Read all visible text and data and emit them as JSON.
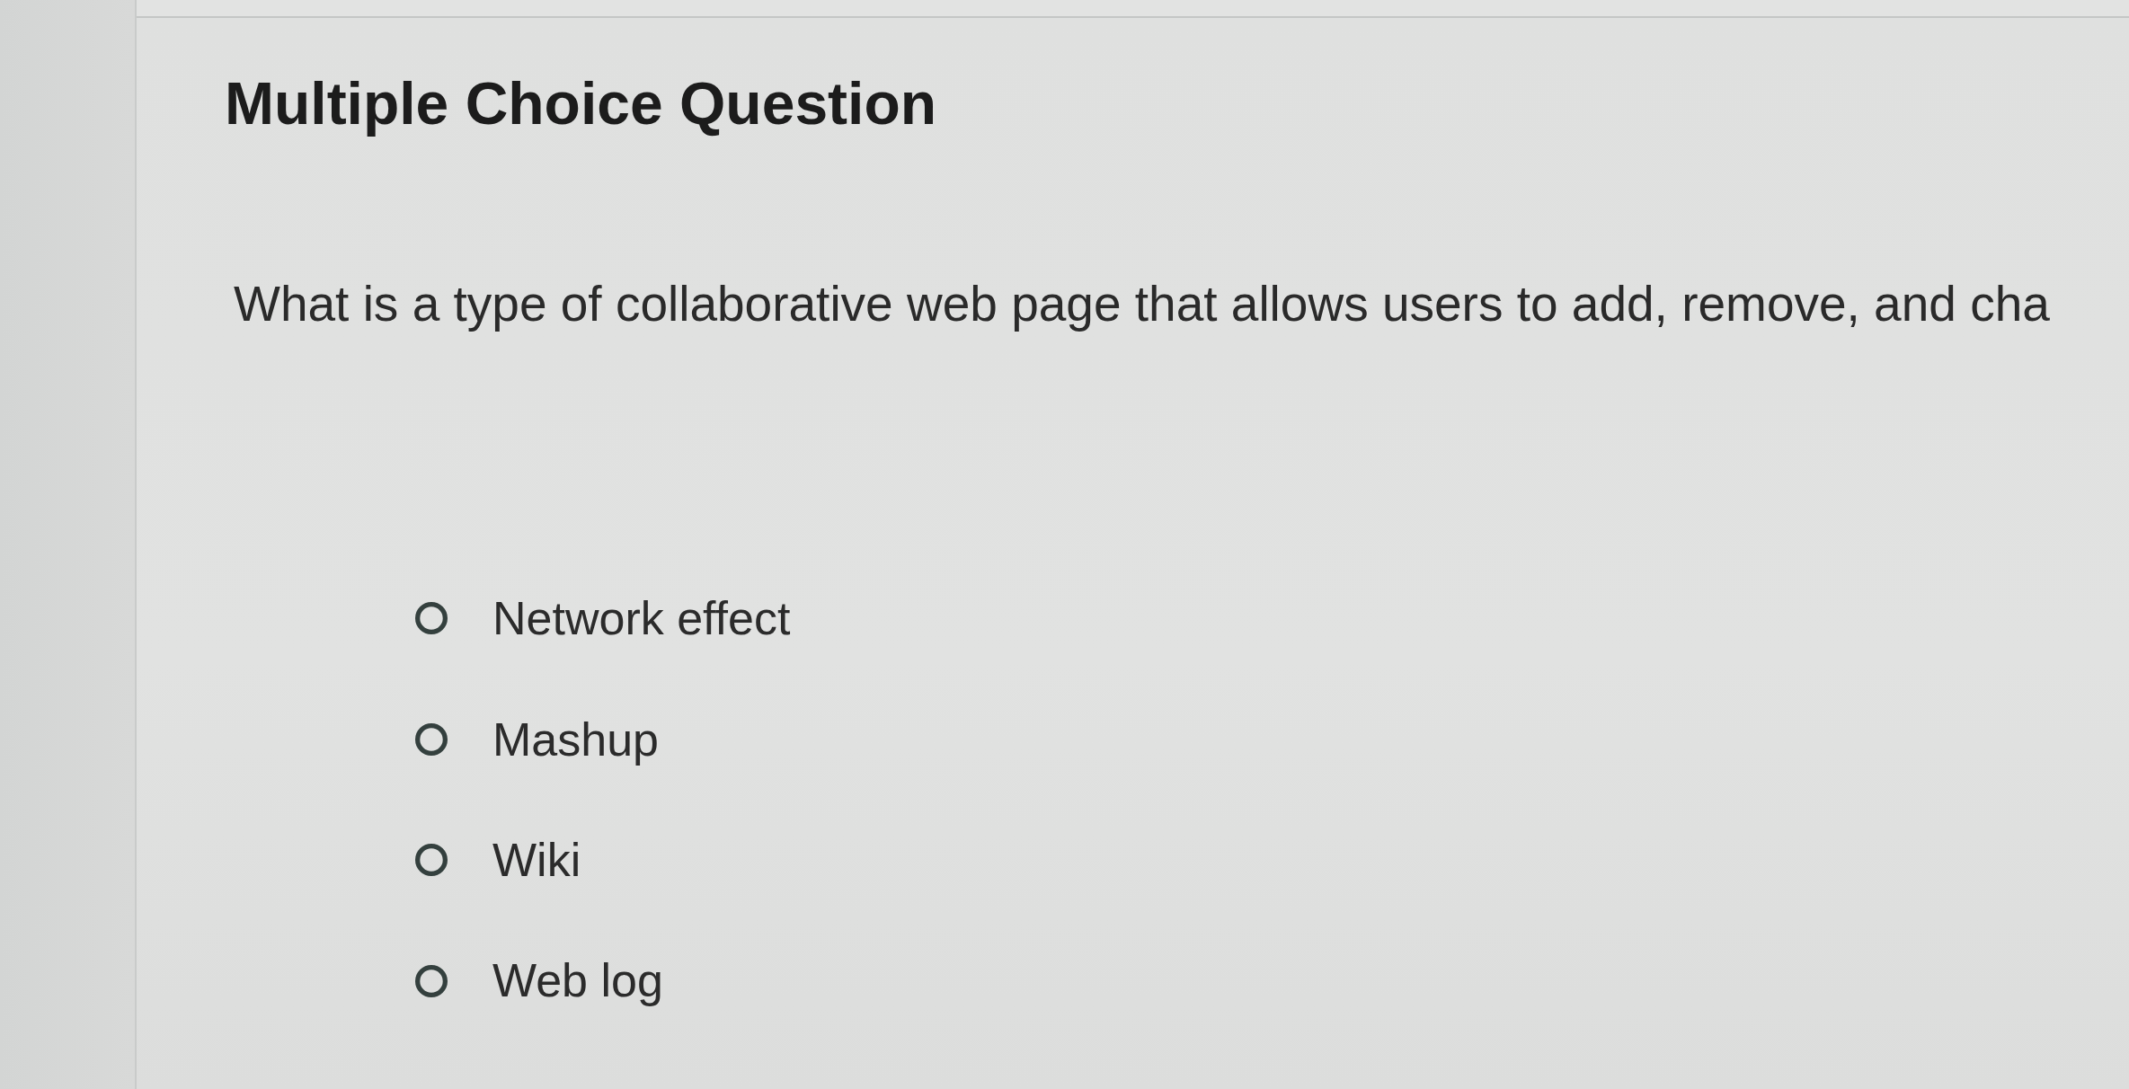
{
  "title": "Multiple Choice Question",
  "question": "What is a type of collaborative web page that allows users to add, remove, and cha",
  "options": [
    {
      "label": "Network effect",
      "selected": false
    },
    {
      "label": "Mashup",
      "selected": false
    },
    {
      "label": "Wiki",
      "selected": false
    },
    {
      "label": "Web log",
      "selected": false
    }
  ]
}
